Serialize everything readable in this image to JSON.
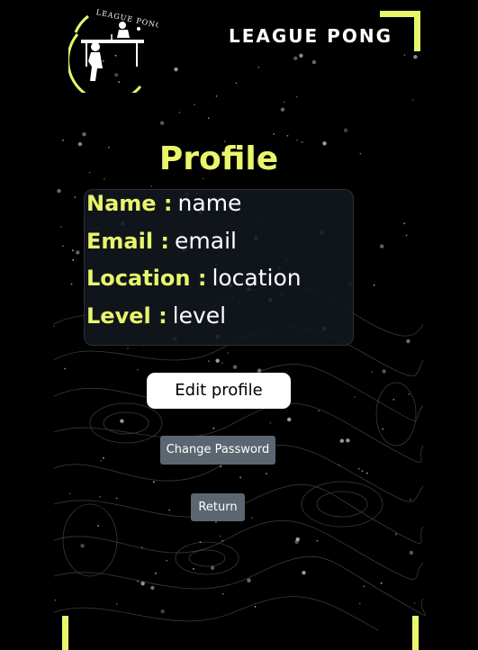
{
  "header": {
    "brand": "LEAGUE PONG",
    "logo_text": "LEAGUE PONG"
  },
  "profile": {
    "title": "Profile",
    "fields": [
      {
        "label": "Name :",
        "value": "name"
      },
      {
        "label": "Email :",
        "value": "email"
      },
      {
        "label": "Location :",
        "value": "location"
      },
      {
        "label": "Level :",
        "value": "level"
      }
    ]
  },
  "actions": {
    "edit_profile": "Edit profile",
    "change_password": "Change Password",
    "return": "Return"
  },
  "colors": {
    "accent": "#e9f56b",
    "background": "#000000",
    "card": "#121820",
    "secondary_button": "#5c6670"
  },
  "icons": [
    "logo-emblem",
    "corner-frame"
  ]
}
